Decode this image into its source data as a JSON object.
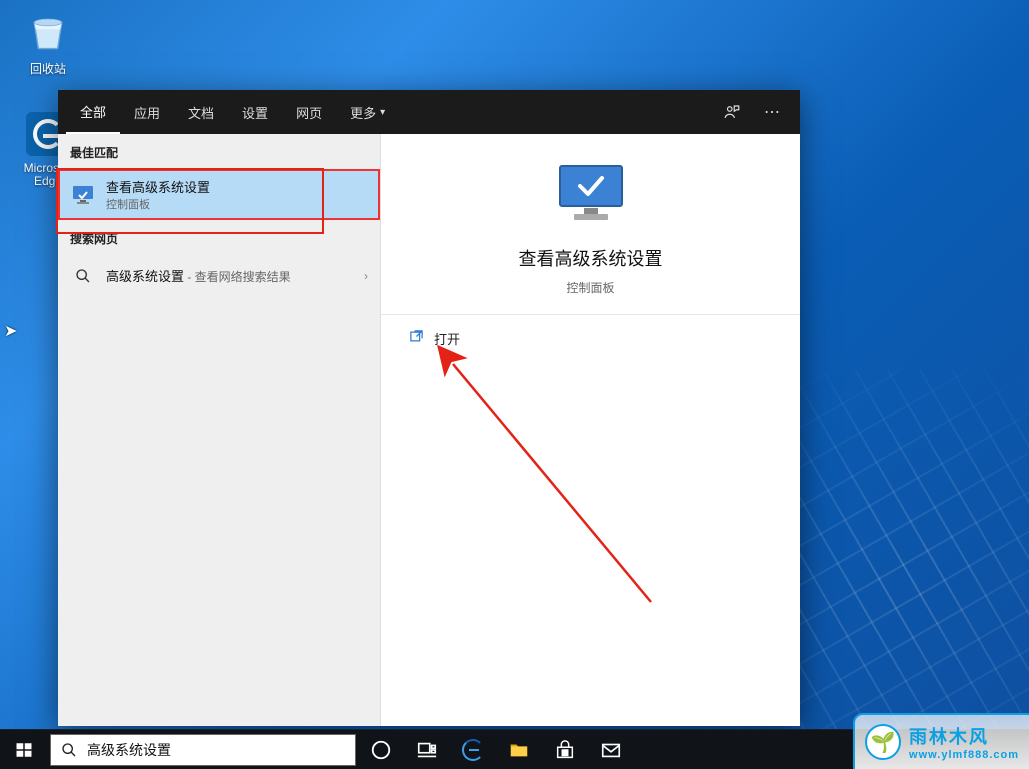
{
  "desktop": {
    "recycle_label": "回收站",
    "edge_label": "Microsoft Edge"
  },
  "search": {
    "tabs": {
      "all": "全部",
      "apps": "应用",
      "docs": "文档",
      "settings": "设置",
      "web": "网页",
      "more": "更多"
    },
    "sections": {
      "best_match": "最佳匹配",
      "search_web": "搜索网页"
    },
    "best_match": {
      "title": "查看高级系统设置",
      "subtitle": "控制面板"
    },
    "web_result": {
      "query": "高级系统设置",
      "suffix": " - 查看网络搜索结果"
    },
    "preview": {
      "title": "查看高级系统设置",
      "subtitle": "控制面板",
      "action_open": "打开"
    },
    "input_value": "高级系统设置"
  },
  "watermark": {
    "brand": "雨林木风",
    "url": "www.ylmf888.com"
  }
}
